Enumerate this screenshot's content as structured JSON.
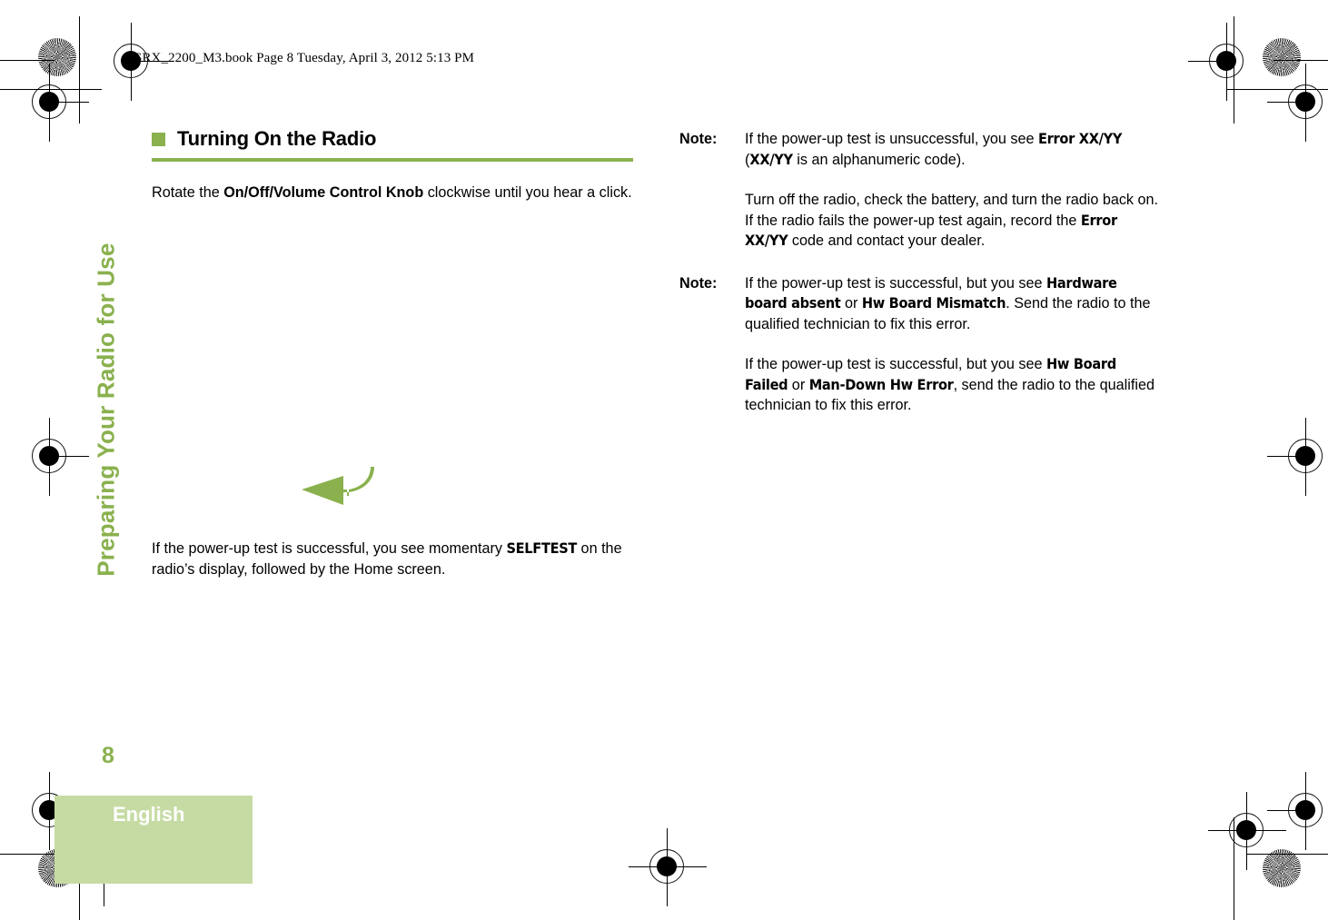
{
  "document": {
    "book_header": "SRX_2200_M3.book  Page 8  Tuesday, April 3, 2012  5:13 PM",
    "chapter_tab": "Preparing Your Radio for Use",
    "page_number": "8",
    "language": "English",
    "accent_color": "#8ab14e",
    "footer_block_color": "#c6dba4"
  },
  "left_column": {
    "heading": "Turning On the Radio",
    "intro": {
      "before_bold": "Rotate the ",
      "bold": "On/Off/Volume Control Knob",
      "after_bold": " clockwise until you hear a click."
    },
    "arrow_icon": "curved-arrow-left-icon",
    "selftest_paragraph": {
      "part1": "If the power-up test is successful, you see momentary ",
      "device_term": "SELFTEST",
      "part2": " on the radio’s display, followed by the Home screen."
    }
  },
  "right_column": {
    "notes": [
      {
        "label": "Note:",
        "paragraphs": [
          {
            "segments": [
              {
                "text": "If the power-up test is unsuccessful, you see ",
                "style": "normal"
              },
              {
                "text": "Error XX/YY",
                "style": "device"
              },
              {
                "text": " (",
                "style": "normal"
              },
              {
                "text": "XX/YY",
                "style": "device"
              },
              {
                "text": " is an alphanumeric code).",
                "style": "normal"
              }
            ]
          },
          {
            "segments": [
              {
                "text": "Turn off the radio, check the battery, and turn the radio back on. If the radio fails the power-up test again, record the ",
                "style": "normal"
              },
              {
                "text": "Error XX/YY",
                "style": "device"
              },
              {
                "text": " code and contact your dealer.",
                "style": "normal"
              }
            ]
          }
        ]
      },
      {
        "label": "Note:",
        "paragraphs": [
          {
            "segments": [
              {
                "text": "If the power-up test is successful, but you see ",
                "style": "normal"
              },
              {
                "text": "Hardware board absent",
                "style": "device"
              },
              {
                "text": " or ",
                "style": "normal"
              },
              {
                "text": "Hw Board Mismatch",
                "style": "device"
              },
              {
                "text": ". Send the radio to the qualified technician to fix this error.",
                "style": "normal"
              }
            ]
          },
          {
            "segments": [
              {
                "text": "If the power-up test is successful, but you see ",
                "style": "normal"
              },
              {
                "text": "Hw Board Failed",
                "style": "device"
              },
              {
                "text": " or ",
                "style": "normal"
              },
              {
                "text": "Man-Down Hw Error",
                "style": "device"
              },
              {
                "text": ", send the radio to the qualified technician to fix this error.",
                "style": "normal"
              }
            ]
          }
        ]
      }
    ]
  }
}
